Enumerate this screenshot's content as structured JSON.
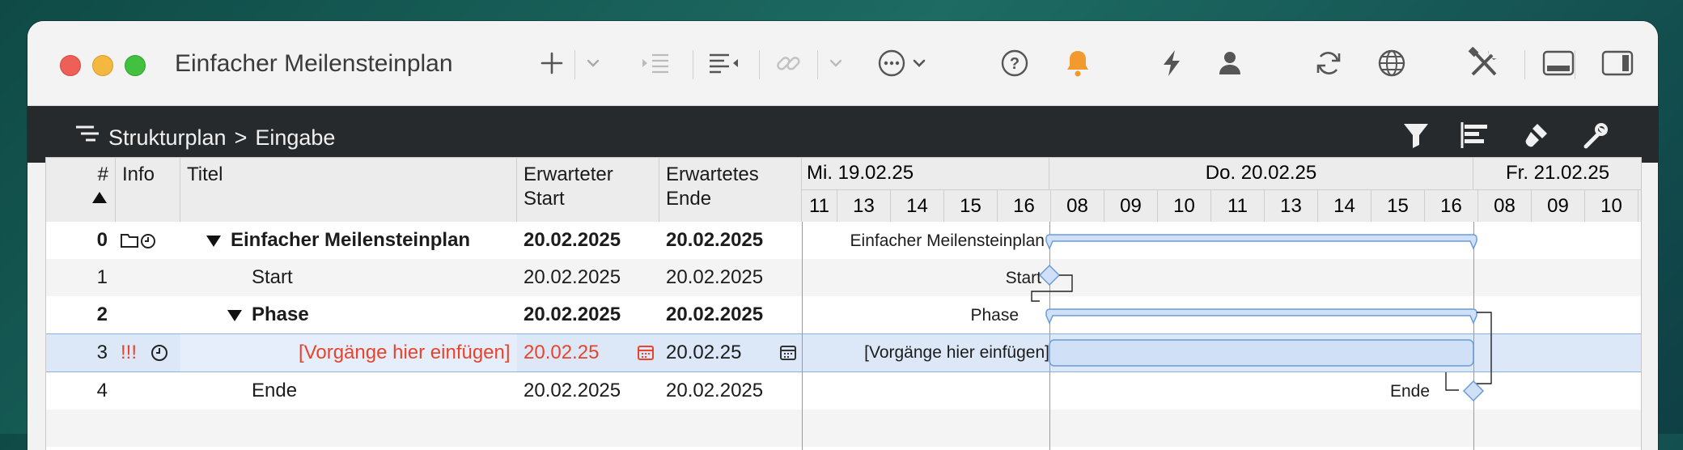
{
  "window": {
    "title": "Einfacher Meilensteinplan"
  },
  "toolbar": {
    "icons": [
      "add-icon",
      "chevron-down-icon",
      "indent-icon",
      "outline-icon",
      "link-icon",
      "chevron-down-icon",
      "more-icon",
      "chevron-down-icon",
      "help-icon",
      "bell-icon",
      "lightning-icon",
      "person-icon",
      "sync-icon",
      "globe-icon",
      "tools-icon",
      "bottom-panel-icon",
      "side-panel-icon"
    ],
    "accent_bell": "#f29a2e"
  },
  "breadcrumb": {
    "root": "Strukturplan",
    "separator": ">",
    "current": "Eingabe"
  },
  "columns": {
    "num": "#",
    "info": "Info",
    "title": "Titel",
    "start_line1": "Erwarteter",
    "start_line2": "Start",
    "end_line1": "Erwartetes",
    "end_line2": "Ende"
  },
  "timeline": {
    "days": [
      "Mi. 19.02.25",
      "Do. 20.02.25",
      "Fr. 21.02.25"
    ],
    "hours": [
      "11",
      "13",
      "14",
      "15",
      "16",
      "08",
      "09",
      "10",
      "11",
      "13",
      "14",
      "15",
      "16",
      "08",
      "09",
      "10"
    ]
  },
  "rows": [
    {
      "num": "0",
      "info": "",
      "title": "Einfacher Meilensteinplan",
      "start": "20.02.2025",
      "end": "20.02.2025",
      "gantt_label": "Einfacher Meilensteinplan"
    },
    {
      "num": "1",
      "info": "",
      "title": "Start",
      "start": "20.02.2025",
      "end": "20.02.2025",
      "gantt_label": "Start"
    },
    {
      "num": "2",
      "info": "",
      "title": "Phase",
      "start": "20.02.2025",
      "end": "20.02.2025",
      "gantt_label": "Phase"
    },
    {
      "num": "3",
      "info": "!!!",
      "title": "[Vorgänge hier einfügen]",
      "start": "20.02.25",
      "end": "20.02.25",
      "gantt_label": "[Vorgänge hier einfügen]"
    },
    {
      "num": "4",
      "info": "",
      "title": "Ende",
      "start": "20.02.2025",
      "end": "20.02.2025",
      "gantt_label": "Ende"
    }
  ],
  "colors": {
    "bar_fill": "#cfe0f7",
    "bar_stroke": "#6a9bd8",
    "selection": "#dce8f7",
    "priority_red": "#e8432b"
  }
}
